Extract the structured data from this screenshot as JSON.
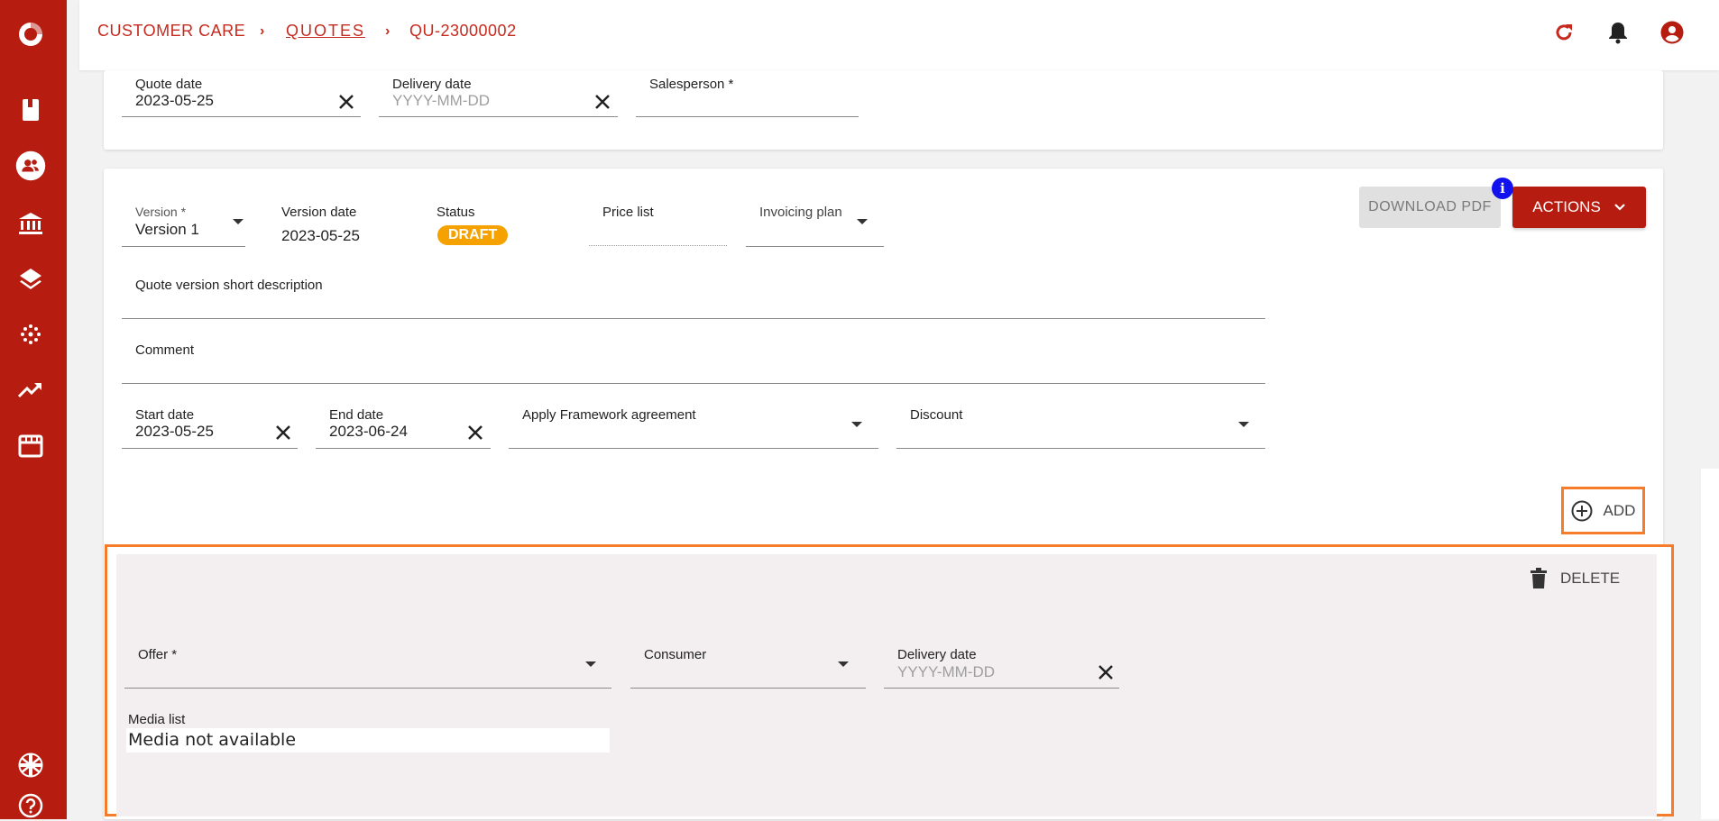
{
  "breadcrumb": {
    "root": "CUSTOMER CARE",
    "section": "QUOTES",
    "current": "QU-23000002"
  },
  "header": {
    "icons": [
      "refresh-icon",
      "bell-icon",
      "account-icon"
    ]
  },
  "sidebar": {
    "icons": [
      "app-logo",
      "book-icon",
      "customers-icon",
      "bank-icon",
      "layers-icon",
      "network-icon",
      "trend-icon",
      "store-icon",
      "uk-flag-icon",
      "help-icon"
    ]
  },
  "quote": {
    "quote_date_label": "Quote date",
    "quote_date_value": "2023-05-25",
    "delivery_date_label": "Delivery date",
    "delivery_date_placeholder": "YYYY-MM-DD",
    "salesperson_label": "Salesperson *"
  },
  "version": {
    "version_label": "Version *",
    "version_value": "Version 1",
    "version_date_label": "Version date",
    "version_date_value": "2023-05-25",
    "status_label": "Status",
    "status_value": "DRAFT",
    "price_list_label": "Price list",
    "invoicing_plan_label": "Invoicing plan",
    "short_description_label": "Quote version short description",
    "comment_label": "Comment",
    "start_date_label": "Start date",
    "start_date_value": "2023-05-25",
    "end_date_label": "End date",
    "end_date_value": "2023-06-24",
    "framework_label": "Apply Framework agreement",
    "discount_label": "Discount",
    "download_pdf": "DOWNLOAD PDF",
    "actions": "ACTIONS",
    "info_badge": "i",
    "add": "ADD"
  },
  "offer": {
    "delete": "DELETE",
    "offer_label": "Offer *",
    "consumer_label": "Consumer",
    "delivery_date_label": "Delivery date",
    "delivery_date_placeholder": "YYYY-MM-DD",
    "media_list_label": "Media list",
    "media_value": "Media not available"
  },
  "colors": {
    "brand": "#b71c10",
    "status_draft": "#f5a200",
    "highlight": "#f47c2a",
    "info": "#1212ee"
  }
}
